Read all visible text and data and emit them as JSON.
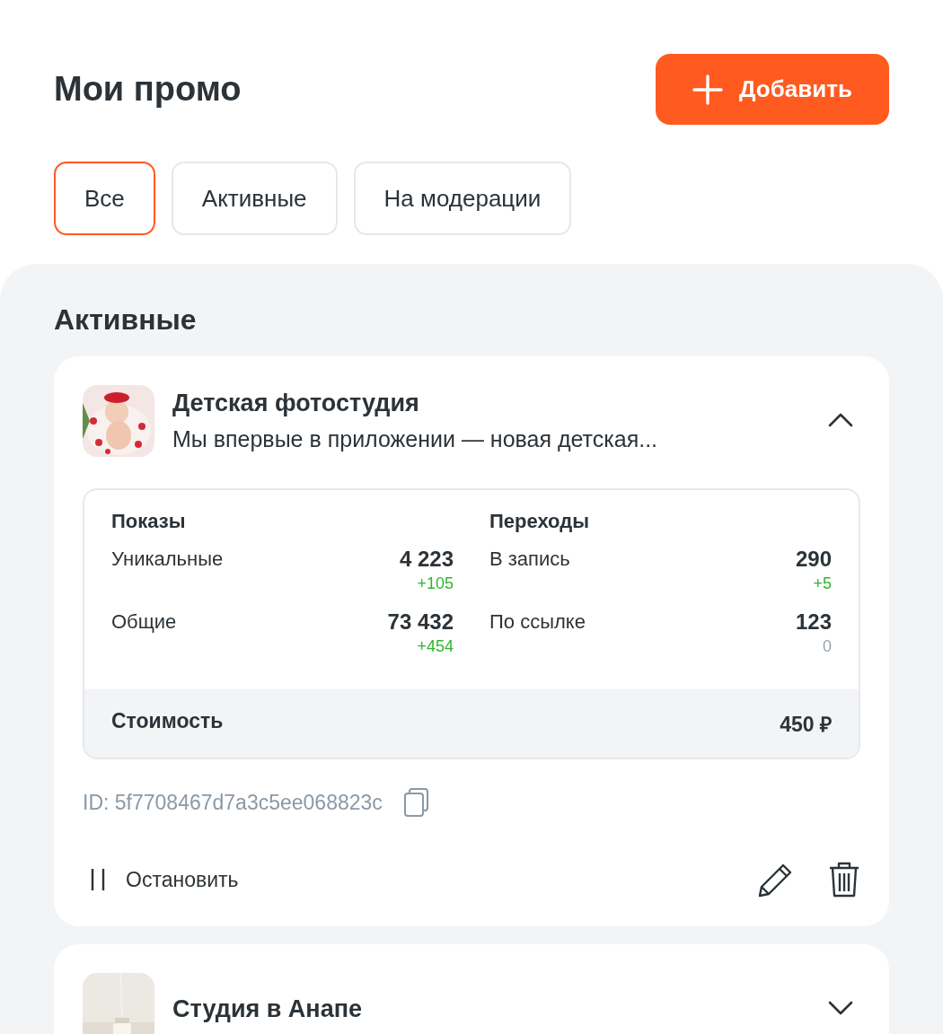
{
  "header": {
    "title": "Мои промо",
    "add_button": {
      "label": "Добавить"
    }
  },
  "filters": [
    {
      "label": "Все",
      "selected": true
    },
    {
      "label": "Активные",
      "selected": false
    },
    {
      "label": "На модерации",
      "selected": false
    }
  ],
  "section": {
    "title": "Активные"
  },
  "promos": [
    {
      "title": "Детская фотостудия",
      "description": "Мы впервые в приложении — новая детская...",
      "expanded": true,
      "thumbnail": {
        "kind": "picture"
      },
      "stats": [
        {
          "title": "Показы",
          "rows": [
            {
              "label": "Уникальные",
              "value": "4 223",
              "delta": "+105",
              "kind": "gain"
            },
            {
              "label": "Общие",
              "value": "73 432",
              "delta": "+454",
              "kind": "gain"
            }
          ]
        },
        {
          "title": "Переходы",
          "rows": [
            {
              "label": "В запись",
              "value": "290",
              "delta": "+5",
              "kind": "gain"
            },
            {
              "label": "По ссылке",
              "value": "123",
              "delta": "0",
              "kind": "zero"
            }
          ]
        }
      ],
      "cost": {
        "label": "Стоимость",
        "value": "450 ₽"
      },
      "id_text": "ID: 5f7708467d7a3c5ee068823c",
      "stop_label": "Остановить"
    },
    {
      "title": "Студия в Анапе",
      "expanded": false,
      "thumbnail": {
        "kind": "picture"
      }
    }
  ]
}
